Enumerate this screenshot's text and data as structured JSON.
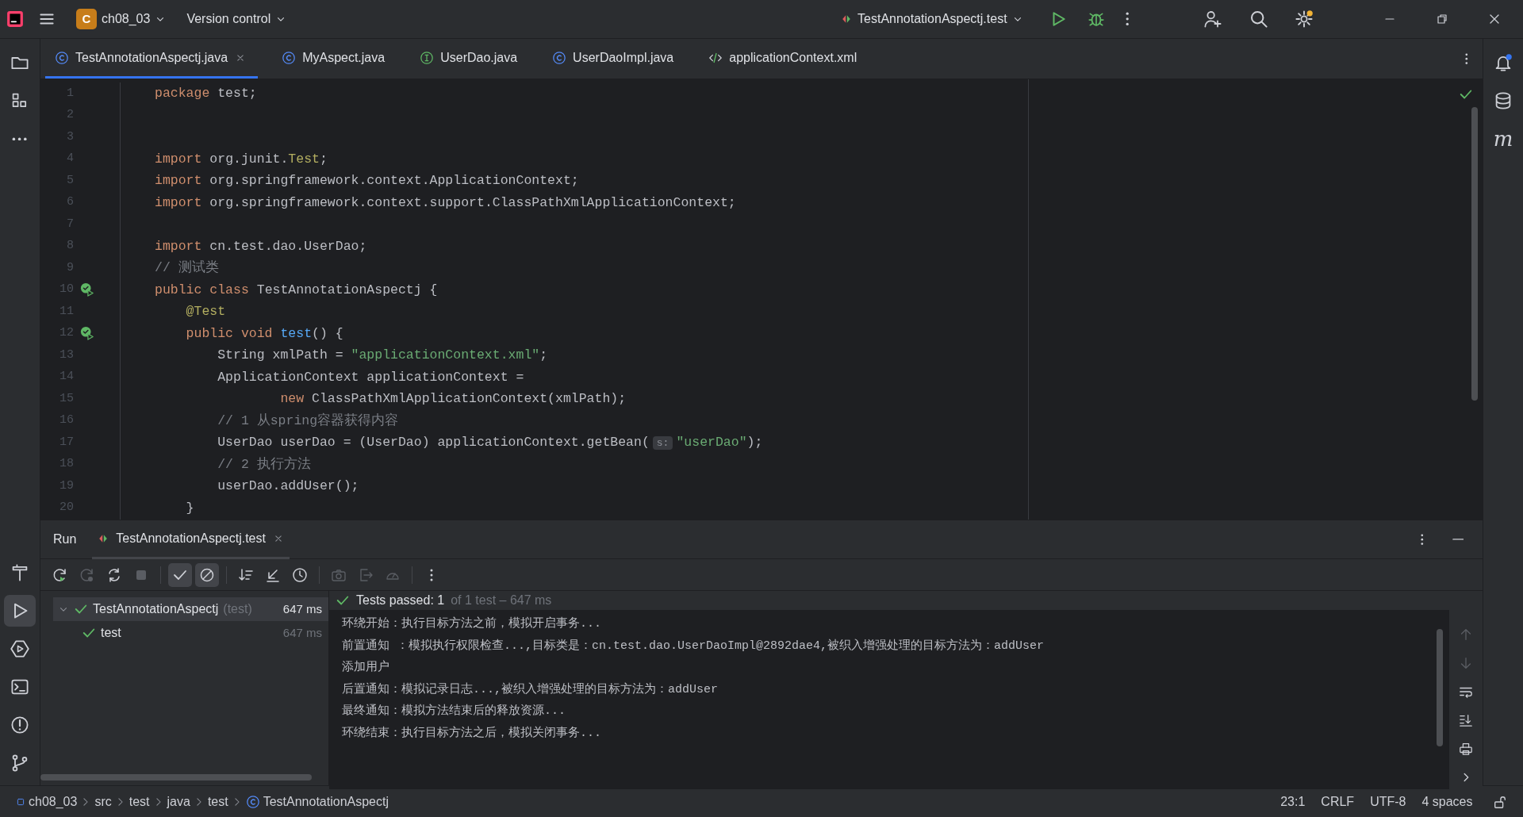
{
  "title_bar": {
    "project_badge": "C",
    "project": "ch08_03",
    "vcs": "Version control",
    "run_config": "TestAnnotationAspectj.test"
  },
  "editor_tabs": [
    {
      "kind": "class",
      "label": "TestAnnotationAspectj.java",
      "selected": true
    },
    {
      "kind": "class",
      "label": "MyAspect.java",
      "selected": false
    },
    {
      "kind": "interface",
      "label": "UserDao.java",
      "selected": false
    },
    {
      "kind": "class",
      "label": "UserDaoImpl.java",
      "selected": false
    },
    {
      "kind": "xml",
      "label": "applicationContext.xml",
      "selected": false
    }
  ],
  "right_toolbar": [
    {
      "kind": "bell"
    },
    {
      "kind": "database"
    },
    {
      "kind": "letter",
      "label": "m"
    }
  ],
  "code_lines": [
    {
      "number": "1",
      "run_marker": false,
      "tokens": [
        {
          "kind": "keyword",
          "text": "package"
        },
        {
          "kind": "plain",
          "text": " test;"
        }
      ]
    },
    {
      "number": "2",
      "run_marker": false
    },
    {
      "number": "3",
      "run_marker": false
    },
    {
      "number": "4",
      "run_marker": false,
      "tokens": [
        {
          "kind": "keyword",
          "text": "import"
        },
        {
          "kind": "plain",
          "text": " org.junit."
        },
        {
          "kind": "annotation",
          "text": "Test"
        },
        {
          "kind": "plain",
          "text": ";"
        }
      ]
    },
    {
      "number": "5",
      "run_marker": false,
      "tokens": [
        {
          "kind": "keyword",
          "text": "import"
        },
        {
          "kind": "plain",
          "text": " org.springframework.context.ApplicationContext;"
        }
      ]
    },
    {
      "number": "6",
      "run_marker": false,
      "tokens": [
        {
          "kind": "keyword",
          "text": "import"
        },
        {
          "kind": "plain",
          "text": " org.springframework.context.support.ClassPathXmlApplicationContext;"
        }
      ]
    },
    {
      "number": "7",
      "run_marker": false
    },
    {
      "number": "8",
      "run_marker": false,
      "tokens": [
        {
          "kind": "keyword",
          "text": "import"
        },
        {
          "kind": "plain",
          "text": " cn.test.dao.UserDao;"
        }
      ]
    },
    {
      "number": "9",
      "run_marker": false,
      "tokens": [
        {
          "kind": "comment",
          "text": "// 测试类"
        }
      ]
    },
    {
      "number": "10",
      "run_marker": true,
      "tokens": [
        {
          "kind": "keyword",
          "text": "public class"
        },
        {
          "kind": "plain",
          "text": " TestAnnotationAspectj {"
        }
      ]
    },
    {
      "number": "11",
      "run_marker": false,
      "tokens": [
        {
          "kind": "annotation",
          "text": "    @Test"
        }
      ]
    },
    {
      "number": "12",
      "run_marker": true,
      "tokens": [
        {
          "kind": "keyword",
          "text": "    public void "
        },
        {
          "kind": "function",
          "text": "test"
        },
        {
          "kind": "plain",
          "text": "() {"
        }
      ]
    },
    {
      "number": "13",
      "run_marker": false,
      "tokens": [
        {
          "kind": "plain",
          "text": "        String xmlPath = "
        },
        {
          "kind": "string",
          "text": "\"applicationContext.xml\""
        },
        {
          "kind": "plain",
          "text": ";"
        }
      ]
    },
    {
      "number": "14",
      "run_marker": false,
      "tokens": [
        {
          "kind": "plain",
          "text": "        ApplicationContext applicationContext ="
        }
      ]
    },
    {
      "number": "15",
      "run_marker": false,
      "tokens": [
        {
          "kind": "keyword",
          "text": "                new"
        },
        {
          "kind": "plain",
          "text": " ClassPathXmlApplicationContext(xmlPath);"
        }
      ]
    },
    {
      "number": "16",
      "run_marker": false,
      "tokens": [
        {
          "kind": "comment",
          "text": "        // 1 从spring容器获得内容"
        }
      ]
    },
    {
      "number": "17",
      "run_marker": false,
      "tokens": [
        {
          "kind": "plain",
          "text": "        UserDao userDao = (UserDao) applicationContext.getBean("
        },
        {
          "kind": "hint",
          "text": "s:"
        },
        {
          "kind": "string",
          "text": "\"userDao\""
        },
        {
          "kind": "plain",
          "text": ");"
        }
      ]
    },
    {
      "number": "18",
      "run_marker": false,
      "tokens": [
        {
          "kind": "comment",
          "text": "        // 2 执行方法"
        }
      ]
    },
    {
      "number": "19",
      "run_marker": false,
      "tokens": [
        {
          "kind": "plain",
          "text": "        userDao.addUser();"
        }
      ]
    },
    {
      "number": "20",
      "run_marker": false,
      "tokens": [
        {
          "kind": "plain",
          "text": "    }"
        }
      ]
    }
  ],
  "run_panel": {
    "title": "Run",
    "tabs": [
      {
        "label": "TestAnnotationAspectj.test",
        "selected": true
      }
    ],
    "toolbar": [
      {
        "kind": "rerun",
        "on": false,
        "disabled": false
      },
      {
        "kind": "rerun-failed",
        "on": false,
        "disabled": true
      },
      {
        "kind": "toggle-auto",
        "on": false,
        "disabled": false
      },
      {
        "kind": "stop",
        "on": false,
        "disabled": true
      },
      {
        "kind": "separator"
      },
      {
        "kind": "show-passed",
        "on": true,
        "disabled": false
      },
      {
        "kind": "show-ignored",
        "on": true,
        "disabled": false
      },
      {
        "kind": "separator"
      },
      {
        "kind": "sort",
        "on": false,
        "disabled": false
      },
      {
        "kind": "import",
        "on": false,
        "disabled": false
      },
      {
        "kind": "history",
        "on": false,
        "disabled": false
      },
      {
        "kind": "separator"
      },
      {
        "kind": "camera",
        "on": false,
        "disabled": true
      },
      {
        "kind": "export",
        "on": false,
        "disabled": true
      },
      {
        "kind": "gauge",
        "on": false,
        "disabled": true
      },
      {
        "kind": "separator"
      },
      {
        "kind": "more",
        "on": false,
        "disabled": false
      }
    ],
    "tree": [
      {
        "label": "TestAnnotationAspectj",
        "detail": "(test)",
        "time": "647 ms",
        "expanded": true,
        "selected": true,
        "children": [
          {
            "label": "test",
            "time": "647 ms",
            "selected": false
          }
        ]
      }
    ],
    "summary": {
      "status": "Tests passed: 1",
      "detail": "of 1 test – 647 ms"
    },
    "console": [
      "环绕开始：执行目标方法之前，模拟开启事务...",
      "前置通知 ：模拟执行权限检查...,目标类是：cn.test.dao.UserDaoImpl@2892dae4,被织入增强处理的目标方法为：addUser",
      "添加用户",
      "后置通知：模拟记录日志...,被织入增强处理的目标方法为：addUser",
      "最终通知：模拟方法结束后的释放资源...",
      "环绕结束：执行目标方法之后，模拟关闭事务..."
    ],
    "console_tools": [
      {
        "kind": "up",
        "disabled": true
      },
      {
        "kind": "down",
        "disabled": true
      },
      {
        "kind": "wrap",
        "disabled": false
      },
      {
        "kind": "scroll-end",
        "disabled": false
      },
      {
        "kind": "print",
        "disabled": false
      },
      {
        "kind": "chevron",
        "disabled": false
      }
    ]
  },
  "breadcrumbs": [
    {
      "kind": "module",
      "label": "ch08_03"
    },
    {
      "kind": "folder",
      "label": "src"
    },
    {
      "kind": "folder",
      "label": "test"
    },
    {
      "kind": "folder",
      "label": "java"
    },
    {
      "kind": "folder",
      "label": "test"
    },
    {
      "kind": "class",
      "label": "TestAnnotationAspectj"
    }
  ],
  "status_items": [
    "23:1",
    "CRLF",
    "UTF-8",
    "4 spaces"
  ]
}
